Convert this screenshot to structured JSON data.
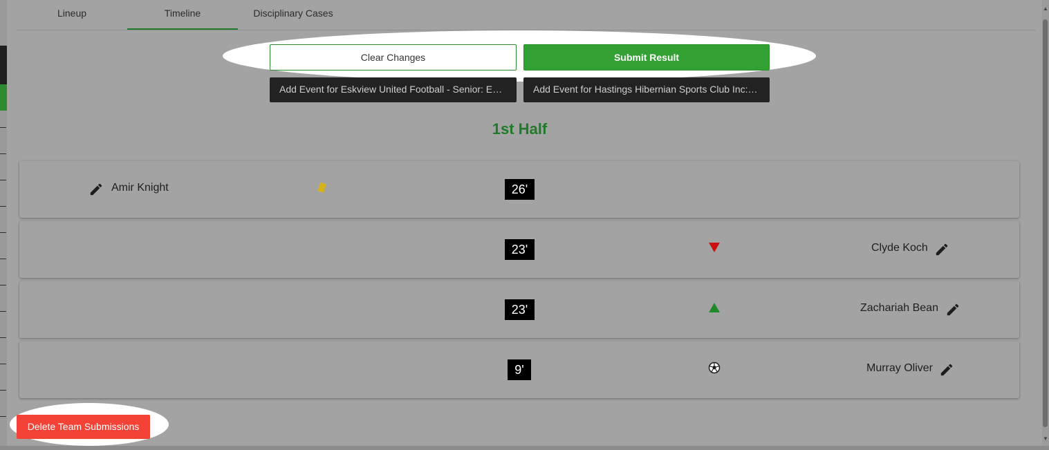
{
  "tabs": [
    {
      "label": "Lineup"
    },
    {
      "label": "Timeline"
    },
    {
      "label": "Disciplinary Cases"
    }
  ],
  "actions": {
    "clear_label": "Clear Changes",
    "submit_label": "Submit Result",
    "add_event_home": "Add Event for Eskview United Football - Senior: Eskview United Football - Senior",
    "add_event_away": "Add Event for Hastings Hibernian Sports Club Inc: Hastings Hibernian Sports Club Inc"
  },
  "section_title": "1st Half",
  "events": [
    {
      "minute": "26'",
      "side": "home",
      "player": "Amir Knight",
      "type": "yellow-card-icon"
    },
    {
      "minute": "23'",
      "side": "away",
      "player": "Clyde Koch",
      "type": "sub-out-icon"
    },
    {
      "minute": "23'",
      "side": "away",
      "player": "Zachariah Bean",
      "type": "sub-in-icon"
    },
    {
      "minute": "9'",
      "side": "away",
      "player": "Murray Oliver",
      "type": "goal-ball-icon"
    }
  ],
  "delete_label": "Delete Team Submissions",
  "colors": {
    "accent_green": "#33a033",
    "title_green": "#1f7a2a",
    "danger_red": "#f44336",
    "yellow_card": "#d4b21c",
    "sub_out_red": "#cc1111",
    "sub_in_green": "#1f8a2a"
  }
}
